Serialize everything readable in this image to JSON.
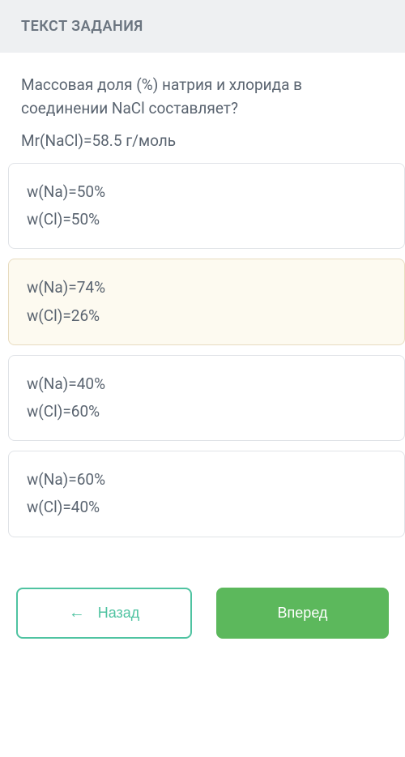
{
  "header": {
    "title": "ТЕКСТ ЗАДАНИЯ"
  },
  "question": {
    "text": "Массовая доля (%) натрия и хлорида в соединении NaCl составляет?",
    "formula": "Mr(NaCl)=58.5 г/моль"
  },
  "options": [
    {
      "line1": "w(Na)=50%",
      "line2": "w(Cl)=50%",
      "selected": false
    },
    {
      "line1": "w(Na)=74%",
      "line2": "w(Cl)=26%",
      "selected": true
    },
    {
      "line1": "w(Na)=40%",
      "line2": "w(Cl)=60%",
      "selected": false
    },
    {
      "line1": "w(Na)=60%",
      "line2": "w(Cl)=40%",
      "selected": false
    }
  ],
  "nav": {
    "back_label": "Назад",
    "forward_label": "Вперед",
    "arrow_left": "←",
    "arrow_right": "→"
  }
}
